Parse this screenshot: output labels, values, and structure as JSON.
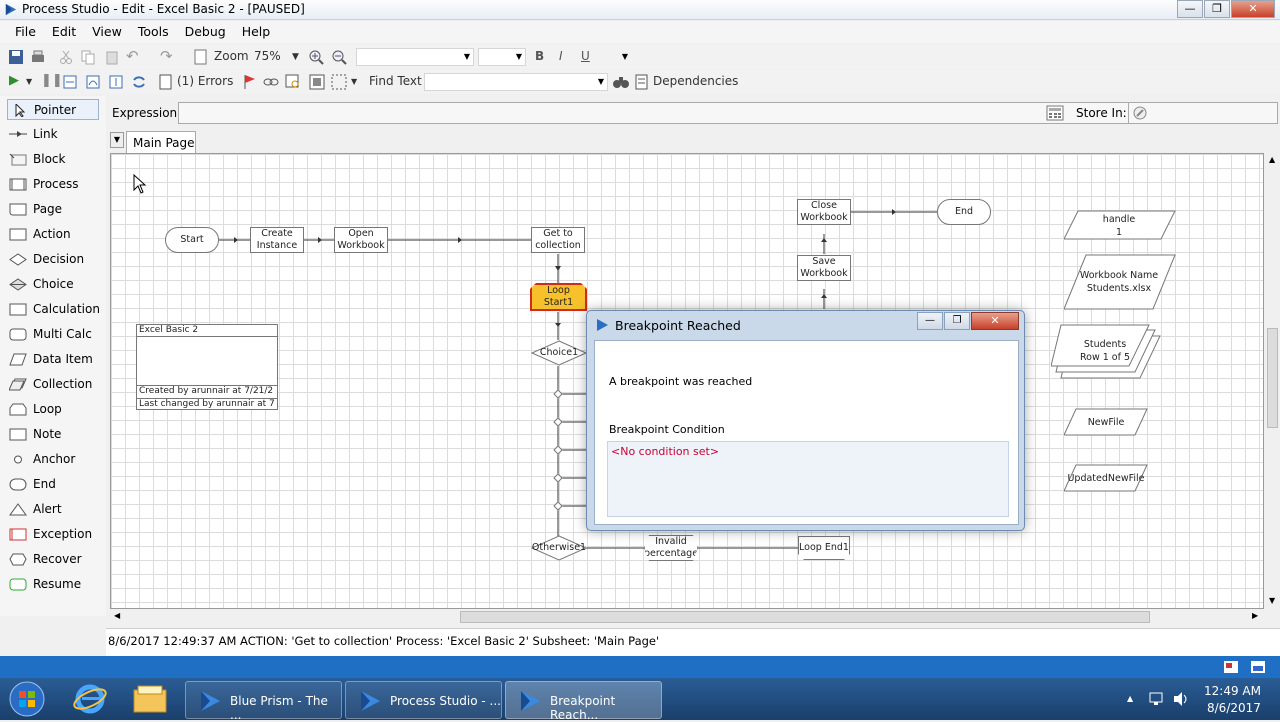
{
  "window": {
    "title": "Process Studio - Edit - Excel Basic 2 - [PAUSED]",
    "min_glyph": "—",
    "max_glyph": "❐",
    "close_glyph": "✕"
  },
  "menu": [
    "File",
    "Edit",
    "View",
    "Tools",
    "Debug",
    "Help"
  ],
  "toolbar1": {
    "zoom_label": "Zoom",
    "zoom_value": "75%",
    "bold": "B",
    "italic": "I",
    "underline": "U"
  },
  "toolbar2": {
    "errors_label": "(1) Errors",
    "find_text_label": "Find Text",
    "dependencies_label": "Dependencies"
  },
  "palette": [
    "Pointer",
    "Link",
    "Block",
    "Process",
    "Page",
    "Action",
    "Decision",
    "Choice",
    "Calculation",
    "Multi Calc",
    "Data Item",
    "Collection",
    "Loop",
    "Note",
    "Anchor",
    "End",
    "Alert",
    "Exception",
    "Recover",
    "Resume"
  ],
  "expression": {
    "label": "Expression:",
    "store_in_label": "Store In:"
  },
  "page_tab": "Main Page",
  "diagram": {
    "start": "Start",
    "create_instance": "Create Instance",
    "open_workbook": "Open Workbook",
    "get_to_collection": "Get to collection",
    "loop_start": "Loop Start1",
    "choice1": "Choice1",
    "otherwise1": "Otherwise1",
    "invalid_percentage": "Invalid percentage",
    "loop_end": "Loop End1",
    "close_workbook": "Close Workbook",
    "save_workbook": "Save Workbook",
    "end": "End",
    "info_box": {
      "title": "Excel Basic 2",
      "created": "Created by  arunnair at 7/21/2",
      "changed": "Last changed by  arunnair at 7"
    },
    "data_items": [
      {
        "name": "handle",
        "value": "1"
      },
      {
        "name": "Workbook Name",
        "value": "Students.xlsx"
      },
      {
        "name": "Students",
        "value": "Row 1 of 5"
      },
      {
        "name": "NewFile",
        "value": ""
      },
      {
        "name": "UpdatedNewFile",
        "value": ""
      }
    ]
  },
  "dialog": {
    "title": "Breakpoint Reached",
    "message": "A breakpoint was reached",
    "condition_label": "Breakpoint Condition",
    "condition_value": "<No condition set>"
  },
  "status": "8/6/2017 12:49:37 AM ACTION: 'Get to collection' Process: 'Excel Basic 2' Subsheet: 'Main Page'",
  "taskbar": {
    "items": [
      "Blue Prism - The ...",
      "Process Studio - ...",
      "Breakpoint Reach..."
    ],
    "time": "12:49 AM",
    "date": "8/6/2017"
  },
  "colors": {
    "accent": "#1f5fa6",
    "highlight_stage": "#f7c12b",
    "highlight_border": "#d42a1c",
    "taskbar": "#1f4a7d"
  }
}
